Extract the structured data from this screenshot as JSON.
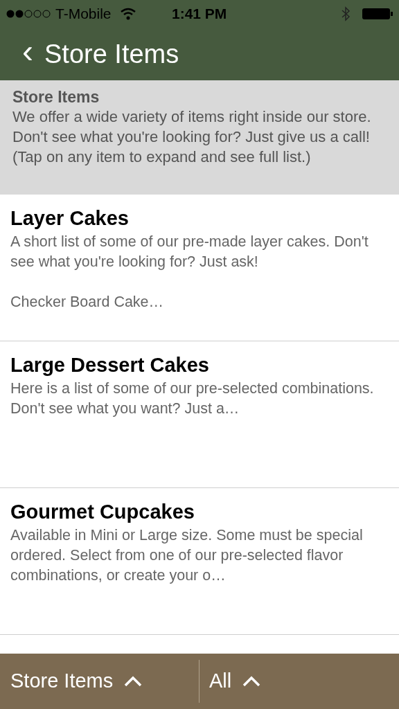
{
  "status_bar": {
    "carrier": "T-Mobile",
    "time": "1:41 PM"
  },
  "nav": {
    "back_icon": "‹",
    "title": "Store Items"
  },
  "intro": {
    "title": "Store Items",
    "text": "We offer a wide variety of items right inside our store. Don't see what you're looking for? Just give us a call! (Tap on any item to expand and see full list.)"
  },
  "items": [
    {
      "title": "Layer Cakes",
      "description": "A short list of some of our pre-made layer cakes. Don't see what you're looking for? Just ask!",
      "preview": "Checker Board Cake…"
    },
    {
      "title": "Large Dessert Cakes",
      "description": "Here is a list of some of our pre-selected combinations. Don't see what you want? Just a…"
    },
    {
      "title": "Gourmet Cupcakes",
      "description": "Available in Mini or Large size. Some must be special ordered. Select from one of our pre-selected flavor combinations, or create your o…"
    }
  ],
  "bottom_bar": [
    {
      "label": "Store Items"
    },
    {
      "label": "All"
    }
  ]
}
